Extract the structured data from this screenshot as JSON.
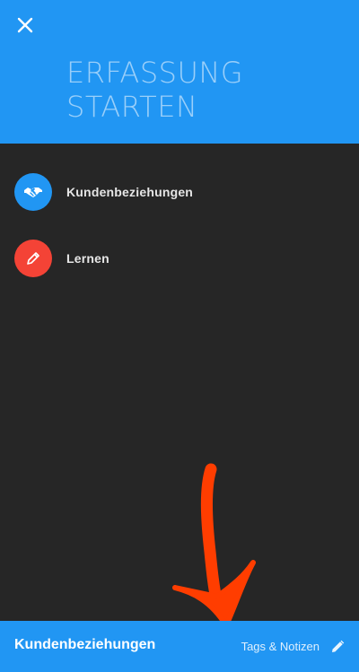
{
  "header": {
    "title": "ERFASSUNG\nSTARTEN",
    "close_icon": "close-icon",
    "background": "#2196F3"
  },
  "menu": {
    "items": [
      {
        "label": "Kundenbeziehungen",
        "icon": "handshake-icon",
        "color": "#2196F3"
      },
      {
        "label": "Lernen",
        "icon": "pencil-icon",
        "color": "#F44336"
      }
    ]
  },
  "bottom_bar": {
    "title": "Kundenbeziehungen",
    "action_label": "Tags & Notizen",
    "action_icon": "pencil-icon"
  },
  "annotation": {
    "color": "#FF3D00"
  }
}
